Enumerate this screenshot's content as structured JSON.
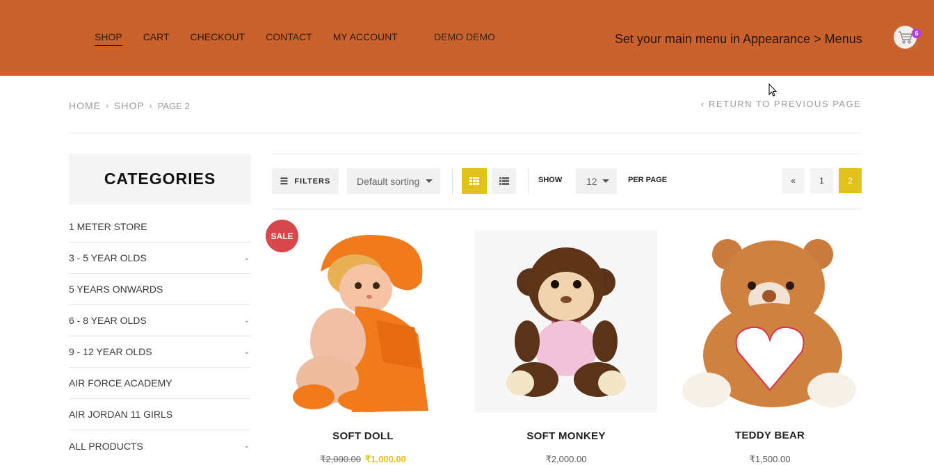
{
  "header": {
    "nav": [
      "SHOP",
      "CART",
      "CHECKOUT",
      "CONTACT",
      "MY ACCOUNT"
    ],
    "demo_label": "DEMO DEMO",
    "menu_note": "Set your main menu in Appearance > Menus",
    "cart_count": "6",
    "cart_icon": "shopping-cart-icon",
    "accent_color": "#c9622d"
  },
  "breadcrumb": {
    "home": "HOME",
    "shop": "SHOP",
    "current": "PAGE 2",
    "return_link": "RETURN TO PREVIOUS PAGE"
  },
  "sidebar": {
    "title": "CATEGORIES",
    "items": [
      {
        "label": "1 METER STORE",
        "expandable": false
      },
      {
        "label": "3 - 5 YEAR OLDS",
        "expandable": true
      },
      {
        "label": "5 YEARS ONWARDS",
        "expandable": false
      },
      {
        "label": "6 - 8 YEAR OLDS",
        "expandable": true
      },
      {
        "label": "9 - 12 YEAR OLDS",
        "expandable": true
      },
      {
        "label": "AIR FORCE ACADEMY",
        "expandable": false
      },
      {
        "label": "AIR JORDAN 11 GIRLS",
        "expandable": false
      },
      {
        "label": "ALL PRODUCTS",
        "expandable": true
      }
    ]
  },
  "toolbar": {
    "filters_label": "FILTERS",
    "sorting": "Default sorting",
    "show_label": "SHOW",
    "per_page_value": "12",
    "per_page_label": "PER PAGE",
    "pagination": {
      "prev": "«",
      "pages": [
        "1",
        "2"
      ],
      "current": "2"
    },
    "highlight_color": "#e2c21a"
  },
  "products": [
    {
      "name": "SOFT DOLL",
      "old_price": "₹2,000.00",
      "price": "₹1,000.00",
      "sale": true,
      "sale_label": "SALE"
    },
    {
      "name": "SOFT MONKEY",
      "old_price": "",
      "price": "₹2,000.00",
      "sale": false
    },
    {
      "name": "TEDDY BEAR",
      "old_price": "",
      "price": "₹1,500.00",
      "sale": false
    }
  ]
}
